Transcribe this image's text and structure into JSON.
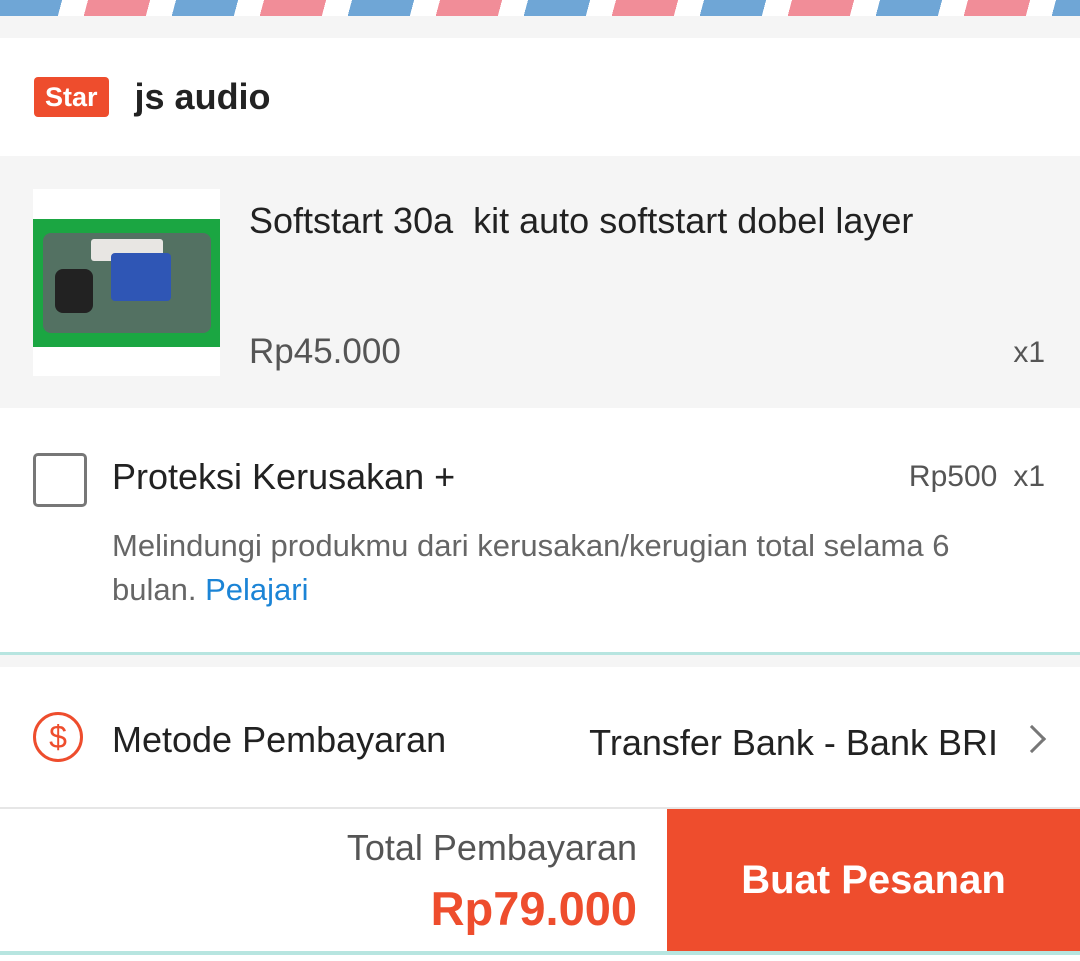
{
  "shop": {
    "badge": "Star",
    "name": "js audio"
  },
  "product": {
    "title": "Softstart 30a  kit auto softstart dobel layer",
    "price": "Rp45.000",
    "qty": "x1",
    "image_icon": "circuit-board-photo"
  },
  "protection": {
    "title": "Proteksi Kerusakan +",
    "price": "Rp500",
    "qty": "x1",
    "description": "Melindungi produkmu dari kerusakan/kerugian total selama 6 bulan.",
    "link": "Pelajari",
    "checked": false
  },
  "payment": {
    "icon": "dollar-circle-icon",
    "label": "Metode Pembayaran",
    "value": "Transfer Bank - Bank BRI"
  },
  "footer": {
    "total_label": "Total Pembayaran",
    "total_value": "Rp79.000",
    "order_button": "Buat Pesanan"
  },
  "colors": {
    "accent": "#ee4d2d",
    "link": "#1b84d6",
    "divider": "#b7e5e0"
  }
}
